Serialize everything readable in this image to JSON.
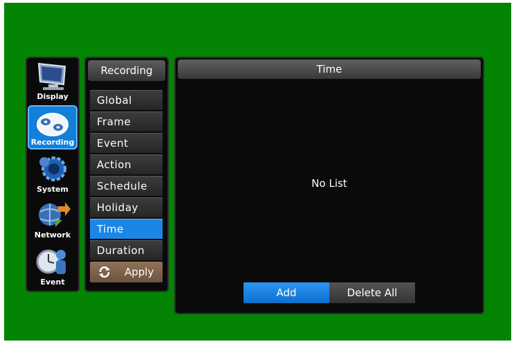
{
  "nav": {
    "items": [
      {
        "label": "Display",
        "icon": "monitor-icon"
      },
      {
        "label": "Recording",
        "icon": "recording-reels-icon",
        "active": true
      },
      {
        "label": "System",
        "icon": "system-gear-icon"
      },
      {
        "label": "Network",
        "icon": "network-globe-icon"
      },
      {
        "label": "Event",
        "icon": "event-clock-icon"
      }
    ]
  },
  "submenu": {
    "title": "Recording",
    "items": [
      "Global",
      "Frame",
      "Event",
      "Action",
      "Schedule",
      "Holiday",
      "Time",
      "Duration"
    ],
    "active": "Time",
    "apply_label": "Apply"
  },
  "panel": {
    "title": "Time",
    "empty_message": "No List",
    "add_label": "Add",
    "delete_all_label": "Delete All"
  },
  "colors": {
    "background": "#038403",
    "accent": "#1a86e6",
    "apply": "#8f7257"
  }
}
